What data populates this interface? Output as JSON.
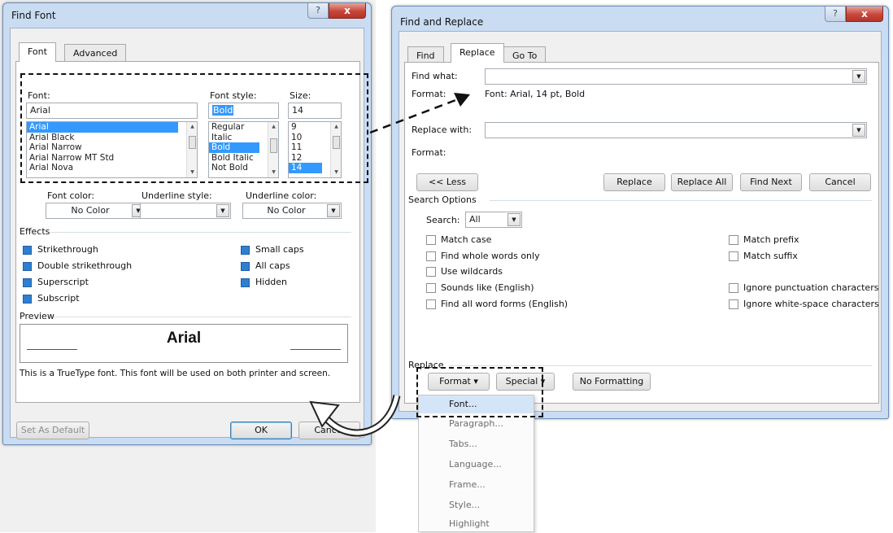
{
  "find_font": {
    "title": "Find Font",
    "help_glyph": "?",
    "close_glyph": "x",
    "tabs": [
      {
        "label": "Font",
        "underline": "n"
      },
      {
        "label": "Advanced",
        "underline": "v"
      }
    ],
    "font_label": "Font:",
    "font_style_label": "Font style:",
    "size_label": "Size:",
    "font_value": "Arial",
    "font_style_value": "Bold",
    "size_value": "14",
    "font_list": [
      "Arial",
      "Arial Black",
      "Arial Narrow",
      "Arial Narrow MT Std",
      "Arial Nova"
    ],
    "font_list_selected": "Arial",
    "style_list": [
      "Regular",
      "Italic",
      "Bold",
      "Bold Italic",
      "Not Bold"
    ],
    "style_list_selected": "Bold",
    "size_list": [
      "9",
      "10",
      "11",
      "12",
      "14"
    ],
    "size_list_selected": "14",
    "font_color_label": "Font color:",
    "font_color_value": "No Color",
    "underline_style_label": "Underline style:",
    "underline_style_value": "",
    "underline_color_label": "Underline color:",
    "underline_color_value": "No Color",
    "effects_title": "Effects",
    "effects_left": [
      "Strikethrough",
      "Double strikethrough",
      "Superscript",
      "Subscript"
    ],
    "effects_right": [
      "Small caps",
      "All caps",
      "Hidden"
    ],
    "preview_title": "Preview",
    "preview_sample": "Arial",
    "preview_note": "This is a TrueType font. This font will be used on both printer and screen.",
    "set_default_label": "Set As Default",
    "ok_label": "OK",
    "cancel_label": "Cancel"
  },
  "find_replace": {
    "title": "Find and Replace",
    "help_glyph": "?",
    "close_glyph": "x",
    "tabs": [
      "Find",
      "Replace",
      "Go To"
    ],
    "find_what_label": "Find what:",
    "find_what_value": "",
    "format_label": "Format:",
    "find_format_value": "Font: Arial, 14 pt, Bold",
    "replace_with_label": "Replace with:",
    "replace_with_value": "",
    "replace_format_value": "",
    "less_label": "<< Less",
    "replace_label": "Replace",
    "replace_all_label": "Replace All",
    "find_next_label": "Find Next",
    "cancel_label": "Cancel",
    "search_options_title": "Search Options",
    "search_label": "Search:",
    "search_value": "All",
    "options_left": [
      "Match case",
      "Find whole words only",
      "Use wildcards",
      "Sounds like (English)",
      "Find all word forms (English)"
    ],
    "options_right": [
      "Match prefix",
      "Match suffix",
      "Ignore punctuation characters",
      "Ignore white-space characters"
    ],
    "replace_section_title": "Replace",
    "format_button_label": "Format ▾",
    "special_button_label": "Special ▾",
    "no_formatting_label": "No Formatting",
    "format_menu": [
      "Font...",
      "Paragraph...",
      "Tabs...",
      "Language...",
      "Frame...",
      "Style...",
      "Highlight"
    ],
    "format_menu_highlighted": "Font..."
  }
}
